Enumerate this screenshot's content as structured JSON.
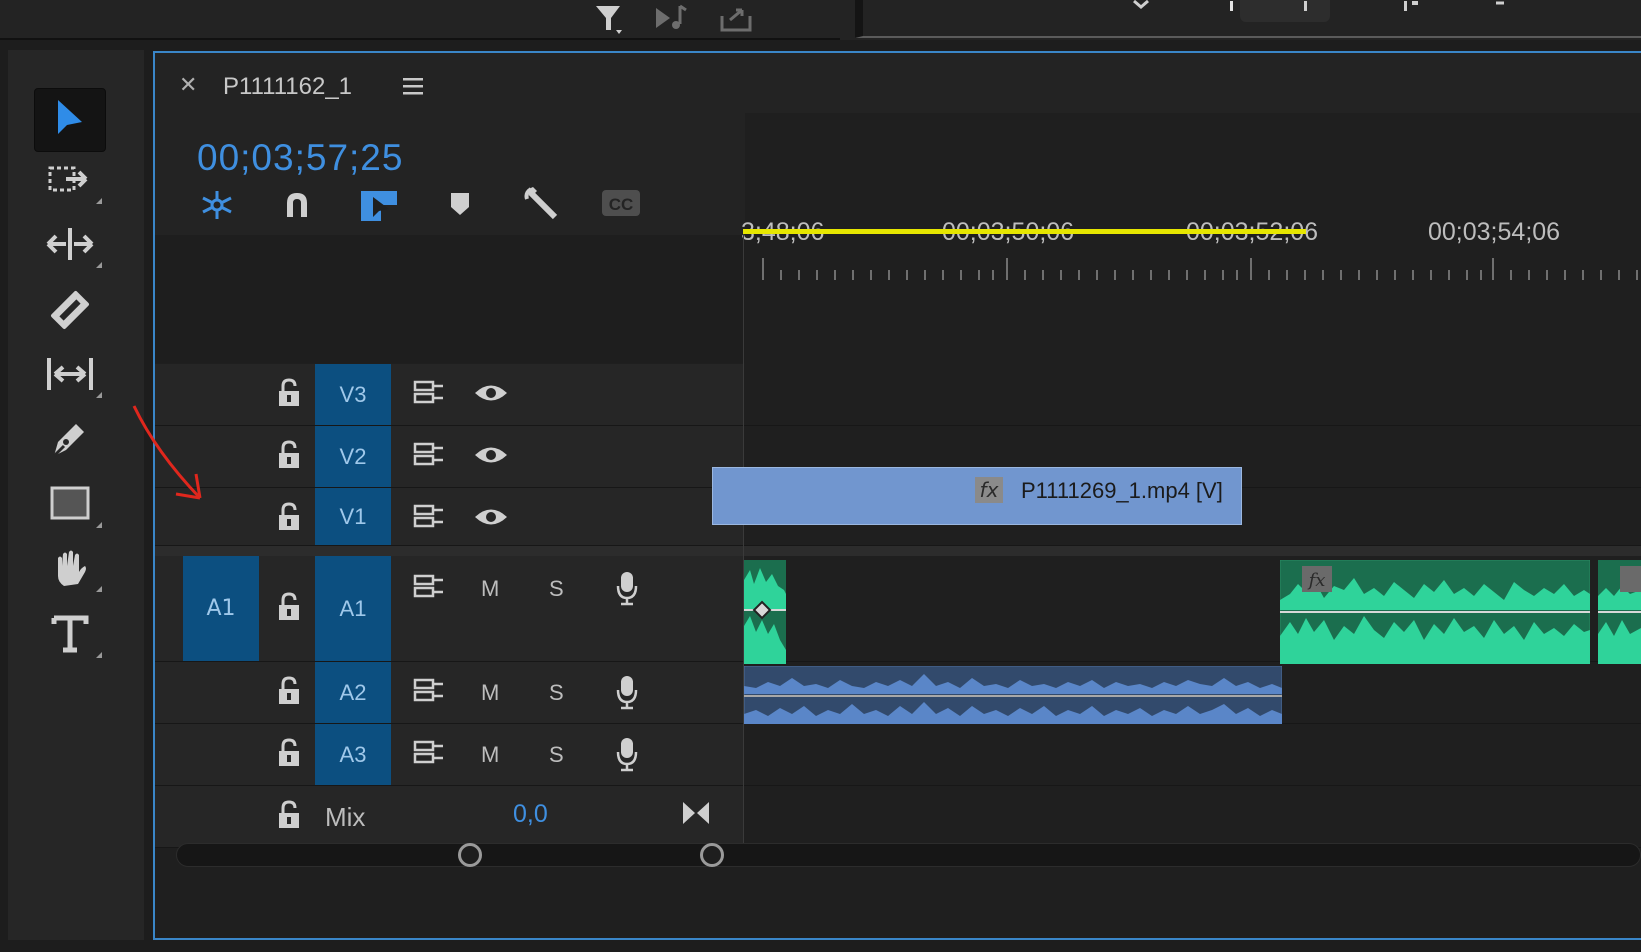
{
  "sequence": {
    "name": "P1111162_1",
    "timecode": "00;03;57;25"
  },
  "ruler": {
    "labels": [
      "3;48;06",
      "00;03;50;06",
      "00;03;52;06",
      "00;03;54;06"
    ]
  },
  "tools": [
    {
      "name": "selection-tool",
      "icon": "arrow-icon",
      "active": true
    },
    {
      "name": "track-select-tool",
      "icon": "track-select-icon"
    },
    {
      "name": "ripple-edit-tool",
      "icon": "ripple-edit-icon"
    },
    {
      "name": "razor-tool",
      "icon": "razor-icon"
    },
    {
      "name": "slip-tool",
      "icon": "slip-icon"
    },
    {
      "name": "pen-tool",
      "icon": "pen-icon"
    },
    {
      "name": "rectangle-tool",
      "icon": "rectangle-icon"
    },
    {
      "name": "hand-tool",
      "icon": "hand-icon"
    },
    {
      "name": "type-tool",
      "icon": "type-icon"
    }
  ],
  "tracks": {
    "video": [
      {
        "target": "V3"
      },
      {
        "target": "V2"
      },
      {
        "target": "V1"
      }
    ],
    "audio": [
      {
        "source": "A1",
        "target": "A1"
      },
      {
        "target": "A2"
      },
      {
        "target": "A3"
      }
    ],
    "mute_label": "M",
    "solo_label": "S",
    "mix_label": "Mix",
    "mix_value": "0,0"
  },
  "clips": {
    "video_clip": {
      "name": "P1111269_1.mp4 [V]",
      "fx": "fx"
    },
    "audio_fx": "fx"
  },
  "colors": {
    "accent": "#3f8fe0",
    "track_target": "#0c4f80",
    "video_clip": "#7196cf",
    "audio_clip_green": "#2fd39a",
    "audio_clip_blue": "#5a86c8",
    "work_area": "#e6e600"
  }
}
